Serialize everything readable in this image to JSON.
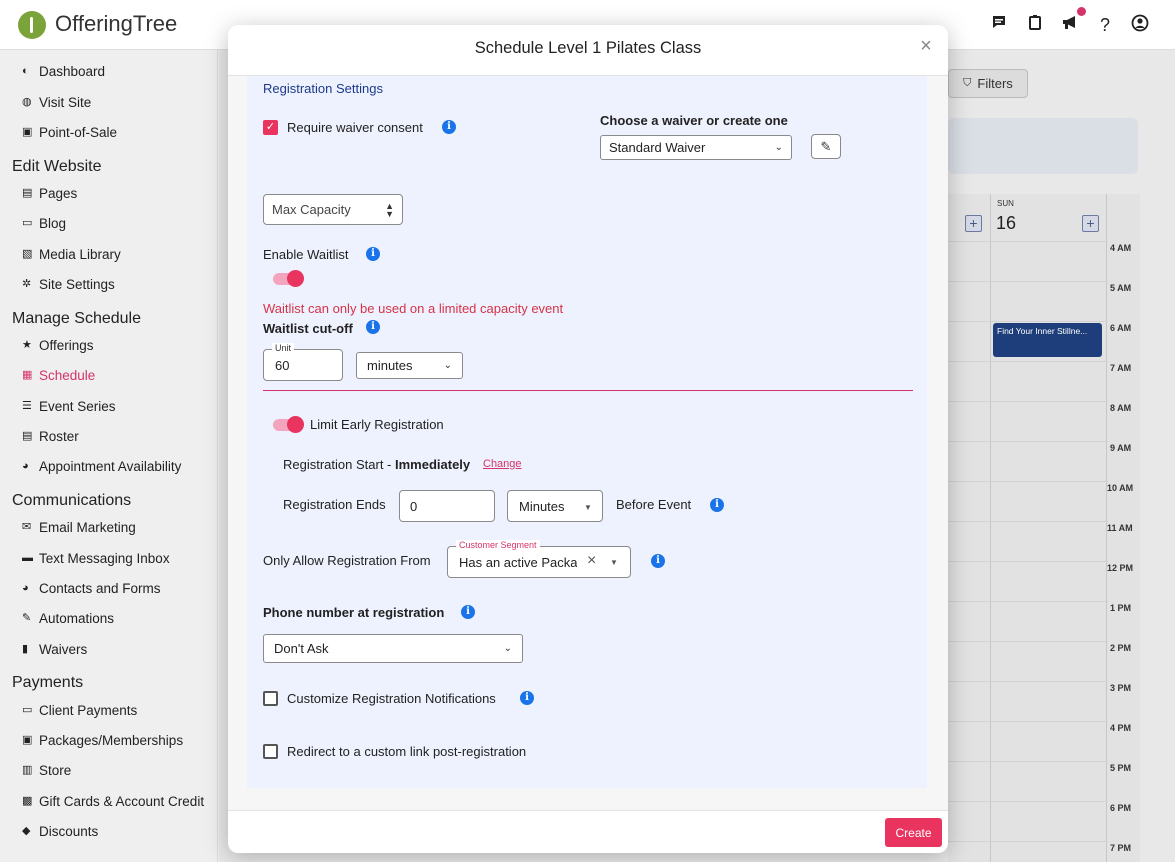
{
  "app": {
    "name": "OfferingTree",
    "brand_color": "#7aa33a",
    "accent": "#e8345f"
  },
  "topbar": {
    "icons": [
      "chat-icon",
      "clipboard-icon",
      "megaphone-icon",
      "help-icon",
      "account-icon"
    ],
    "help_glyph": "?"
  },
  "sidebar": {
    "items_top": [
      {
        "label": "Dashboard",
        "icon": "palette-icon"
      },
      {
        "label": "Visit Site",
        "icon": "globe-icon"
      },
      {
        "label": "Point-of-Sale",
        "icon": "register-icon"
      }
    ],
    "sections": [
      {
        "title": "Edit Website",
        "items": [
          {
            "label": "Pages",
            "icon": "pages-icon"
          },
          {
            "label": "Blog",
            "icon": "blog-icon"
          },
          {
            "label": "Media Library",
            "icon": "image-icon"
          },
          {
            "label": "Site Settings",
            "icon": "gear-icon"
          }
        ]
      },
      {
        "title": "Manage Schedule",
        "items": [
          {
            "label": "Offerings",
            "icon": "star-icon"
          },
          {
            "label": "Schedule",
            "icon": "calendar-icon",
            "active": true
          },
          {
            "label": "Event Series",
            "icon": "list-icon"
          },
          {
            "label": "Roster",
            "icon": "roster-icon"
          },
          {
            "label": "Appointment Availability",
            "icon": "people-icon"
          }
        ]
      },
      {
        "title": "Communications",
        "items": [
          {
            "label": "Email Marketing",
            "icon": "mail-icon"
          },
          {
            "label": "Text Messaging Inbox",
            "icon": "sms-icon"
          },
          {
            "label": "Contacts and Forms",
            "icon": "contacts-icon"
          },
          {
            "label": "Automations",
            "icon": "magic-icon"
          },
          {
            "label": "Waivers",
            "icon": "document-icon"
          }
        ]
      },
      {
        "title": "Payments",
        "items": [
          {
            "label": "Client Payments",
            "icon": "card-icon"
          },
          {
            "label": "Packages/Memberships",
            "icon": "package-icon"
          },
          {
            "label": "Store",
            "icon": "store-icon"
          },
          {
            "label": "Gift Cards & Account Credit",
            "icon": "gift-icon"
          },
          {
            "label": "Discounts",
            "icon": "tag-icon"
          }
        ]
      }
    ]
  },
  "background": {
    "filters_label": "Filters",
    "day_name": "SUN",
    "day_number": "16",
    "hours": [
      "4 AM",
      "5 AM",
      "6 AM",
      "7 AM",
      "8 AM",
      "9 AM",
      "10 AM",
      "11 AM",
      "12 PM",
      "1 PM",
      "2 PM",
      "3 PM",
      "4 PM",
      "5 PM",
      "6 PM",
      "7 PM"
    ],
    "event_title": "Find Your Inner Stillne..."
  },
  "modal": {
    "title": "Schedule Level 1 Pilates Class",
    "close_glyph": "×",
    "section_title": "Registration Settings",
    "require_waiver": {
      "label": "Require waiver consent",
      "checked": true
    },
    "waiver_choose_label": "Choose a waiver or create one",
    "waiver_select_value": "Standard Waiver",
    "capacity_select_value": "Max Capacity",
    "enable_waitlist": {
      "label": "Enable Waitlist",
      "on": true
    },
    "waitlist_error": "Waitlist can only be used on a limited capacity event",
    "waitlist_cutoff_label": "Waitlist cut-off",
    "cutoff_unit_label": "Unit",
    "cutoff_unit_value": "60",
    "cutoff_unit_select": "minutes",
    "limit_early": {
      "label": "Limit Early Registration",
      "on": true
    },
    "reg_start_label": "Registration Start - ",
    "reg_start_value": "Immediately",
    "reg_start_change": "Change",
    "reg_ends_label": "Registration Ends",
    "reg_ends_value": "0",
    "reg_ends_unit": "Minutes",
    "reg_ends_suffix": "Before Event",
    "only_allow_label": "Only Allow Registration From",
    "segment_label": "Customer Segment",
    "segment_value": "Has an active Packag",
    "phone_label": "Phone number at registration",
    "phone_select_value": "Don't Ask",
    "customize_notifications": {
      "label": "Customize Registration Notifications",
      "checked": false
    },
    "redirect": {
      "label": "Redirect to a custom link post-registration",
      "checked": false
    },
    "create_label": "Create",
    "info_glyph": "i"
  }
}
